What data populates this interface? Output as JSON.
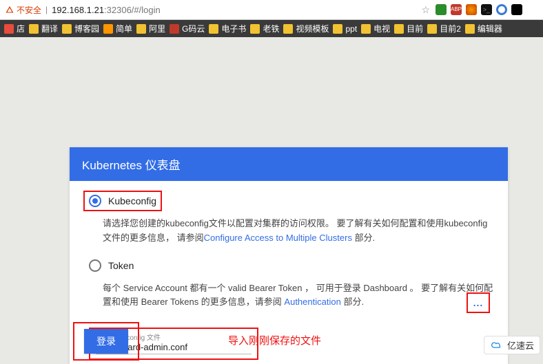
{
  "addressbar": {
    "warning_text": "不安全",
    "url_host": "192.168.1.21",
    "url_rest": ":32306/#/login"
  },
  "bookmarks": [
    {
      "label": "店",
      "color": "#e74c3c"
    },
    {
      "label": "翻译",
      "color": "#f1c232"
    },
    {
      "label": "博客园",
      "color": "#f1c232"
    },
    {
      "label": "简单",
      "color": "#ff9500"
    },
    {
      "label": "阿里",
      "color": "#f1c232"
    },
    {
      "label": "G码云",
      "color": "#c0392b"
    },
    {
      "label": "电子书",
      "color": "#f1c232"
    },
    {
      "label": "老铁",
      "color": "#f1c232"
    },
    {
      "label": "视频模板",
      "color": "#f1c232"
    },
    {
      "label": "ppt",
      "color": "#f1c232"
    },
    {
      "label": "电视",
      "color": "#f1c232"
    },
    {
      "label": "目前",
      "color": "#f1c232"
    },
    {
      "label": "目前2",
      "color": "#f1c232"
    },
    {
      "label": "编辑器",
      "color": "#f1c232"
    }
  ],
  "card": {
    "title": "Kubernetes 仪表盘",
    "option1": {
      "label": "Kubeconfig",
      "selected": true,
      "desc_pre": "请选择您创建的kubeconfig文件以配置对集群的访问权限。 要了解有关如何配置和使用kubeconfig文件的更多信息， 请参阅",
      "desc_link": "Configure Access to Multiple Clusters",
      "desc_post": " 部分."
    },
    "option2": {
      "label": "Token",
      "selected": false,
      "desc_pre": "每个 Service Account 都有一个 valid Bearer Token ， 可用于登录 Dashboard 。 要了解有关如何配置和使用 Bearer Tokens 的更多信息，请参阅 ",
      "desc_link": "Authentication",
      "desc_post": " 部分."
    },
    "file_field": {
      "label": "选择 kubeconfig 文件",
      "value": ".dashboard-admin.conf"
    },
    "browse_dots": "...",
    "login": "登录"
  },
  "annotation": "导入刚刚保存的文件",
  "brand": "亿速云"
}
